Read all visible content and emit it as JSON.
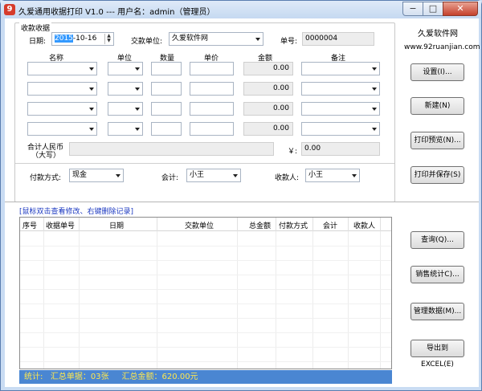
{
  "window": {
    "title": "久爱通用收据打印 V1.0 --- 用户名：admin（管理员）",
    "controls": {
      "minimize": "−",
      "maximize": "□",
      "close": "✕"
    }
  },
  "form": {
    "group_title": "收款收据",
    "date_label": "日期:",
    "date_value_selected": "2015",
    "date_value_rest": "-10-16",
    "payer_label": "交款单位:",
    "payer_value": "久爱软件网",
    "number_label": "单号:",
    "number_value": "0000004",
    "columns": [
      "名称",
      "单位",
      "数量",
      "单价",
      "金额",
      "备注"
    ],
    "rows": [
      {
        "amount": "0.00"
      },
      {
        "amount": "0.00"
      },
      {
        "amount": "0.00"
      },
      {
        "amount": "0.00"
      }
    ],
    "total_label_line1": "合计人民币",
    "total_label_line2": "（大写）",
    "total_upper_value": "",
    "yen_label": "￥:",
    "total_value": "0.00",
    "payment_label": "付款方式:",
    "payment_value": "现金",
    "accountant_label": "会计:",
    "accountant_value": "小王",
    "payee_label": "收款人:",
    "payee_value": "小王"
  },
  "brand": {
    "name": "久爱软件网",
    "url": "www.92ruanjian.com"
  },
  "buttons": {
    "settings": "设置(I)...",
    "new": "新建(N)",
    "print_preview": "打印预览(N)...",
    "print_save": "打印并保存(S)",
    "query": "查询(Q)...",
    "sales_stats": "销售统计C)...",
    "manage_data": "管理数据(M)...",
    "export_excel": "导出到EXCEL(E)"
  },
  "records": {
    "hint": "[鼠标双击查看修改、右键删除记录]",
    "columns": [
      "序号",
      "收据单号",
      "日期",
      "交款单位",
      "总金额",
      "付款方式",
      "会计",
      "收款人"
    ]
  },
  "status": {
    "stats_label": "统计:",
    "total_count": "汇总单据：03张",
    "total_amount": "汇总金额：620.00元"
  }
}
